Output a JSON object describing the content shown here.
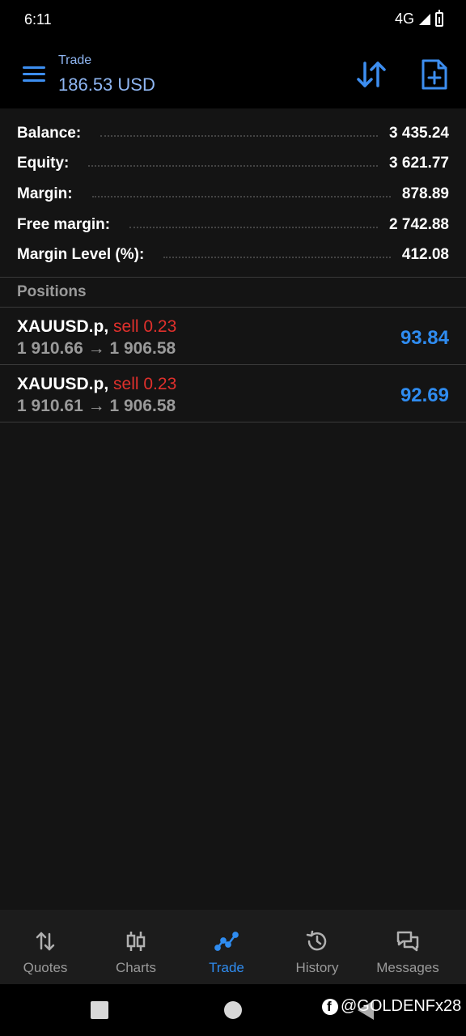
{
  "status_bar": {
    "time": "6:11",
    "network": "4G"
  },
  "app_bar": {
    "label": "Trade",
    "balance": "186.53 USD",
    "icons": [
      "menu-icon",
      "sort-icon",
      "new-order-icon"
    ],
    "accent_color": "#3d8ef0"
  },
  "summary": [
    {
      "label": "Balance:",
      "value": "3 435.24"
    },
    {
      "label": "Equity:",
      "value": "3 621.77"
    },
    {
      "label": "Margin:",
      "value": "878.89"
    },
    {
      "label": "Free margin:",
      "value": "2 742.88"
    },
    {
      "label": "Margin Level (%):",
      "value": "412.08"
    }
  ],
  "positions": {
    "title": "Positions",
    "items": [
      {
        "symbol": "XAUUSD.p,",
        "type": "sell 0.23",
        "open_price": "1 910.66",
        "arrow": "→",
        "current_price": "1 906.58",
        "profit": "93.84"
      },
      {
        "symbol": "XAUUSD.p,",
        "type": "sell 0.23",
        "open_price": "1 910.61",
        "arrow": "→",
        "current_price": "1 906.58",
        "profit": "92.69"
      }
    ],
    "sell_color": "#e0302c",
    "profit_color": "#2f8cf0"
  },
  "bottom_nav": {
    "items": [
      {
        "label": "Quotes",
        "icon": "quotes-icon"
      },
      {
        "label": "Charts",
        "icon": "charts-icon"
      },
      {
        "label": "Trade",
        "icon": "trade-icon",
        "active": true
      },
      {
        "label": "History",
        "icon": "history-icon"
      },
      {
        "label": "Messages",
        "icon": "messages-icon"
      }
    ]
  },
  "watermark": {
    "text": "@GOLDENFx28",
    "icon": "facebook-icon"
  }
}
